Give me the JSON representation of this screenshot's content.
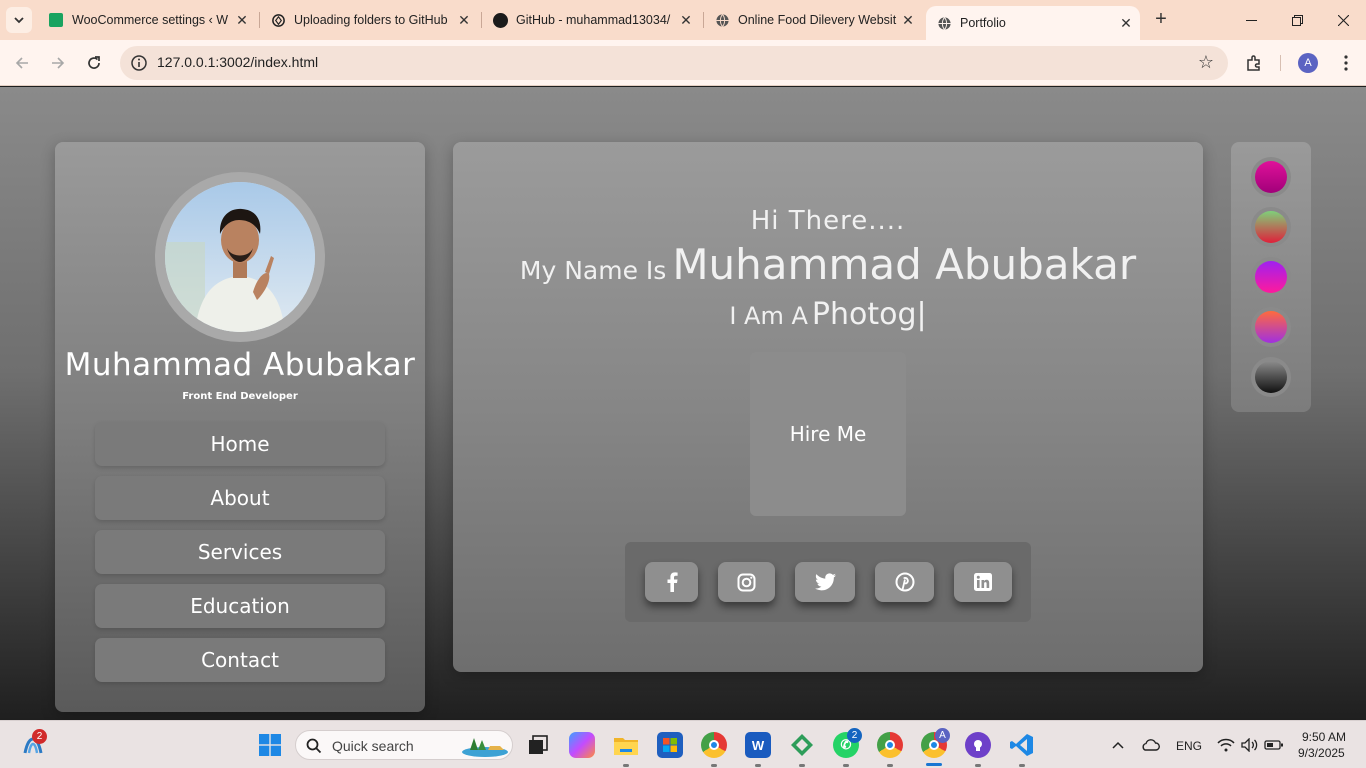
{
  "browser": {
    "tabs": [
      {
        "title": "WooCommerce settings ‹ W",
        "icon": "woocommerce-icon",
        "active": false
      },
      {
        "title": "Uploading folders to GitHub",
        "icon": "chatgpt-icon",
        "active": false
      },
      {
        "title": "GitHub - muhammad13034/",
        "icon": "github-icon",
        "active": false
      },
      {
        "title": "Online Food Dilevery Websit",
        "icon": "globe-icon",
        "active": false
      },
      {
        "title": "Portfolio",
        "icon": "globe-icon",
        "active": true
      }
    ],
    "url": "127.0.0.1:3002/index.html",
    "profile_initial": "A"
  },
  "sidebar": {
    "name": "Muhammad Abubakar",
    "role": "Front End Developer",
    "nav": [
      "Home",
      "About",
      "Services",
      "Education",
      "Contact"
    ]
  },
  "hero": {
    "greeting": "Hi There....",
    "name_lead": "My Name Is",
    "name": "Muhammad Abubakar",
    "role_lead": "I Am A",
    "typed_text": "Photog|",
    "hire_label": "Hire Me",
    "socials": [
      "facebook-icon",
      "instagram-icon",
      "twitter-icon",
      "pinterest-icon",
      "linkedin-icon"
    ]
  },
  "theme_swatches": [
    {
      "name": "pink",
      "from": "#e0119a",
      "to": "#a1007a"
    },
    {
      "name": "green-red",
      "from": "#7fd07a",
      "to": "#e0203a"
    },
    {
      "name": "purple-pink",
      "from": "#a020f0",
      "to": "#ff1a9c"
    },
    {
      "name": "orange-purple",
      "from": "#ff6a3d",
      "to": "#a030e0"
    },
    {
      "name": "gray-black",
      "from": "#8c8c8c",
      "to": "#111111"
    }
  ],
  "taskbar": {
    "search_placeholder": "Quick search",
    "language": "ENG",
    "time": "9:50 AM",
    "date": "9/3/2025",
    "widgets_badge": "2",
    "whatsapp_badge": "2",
    "chrome_profile_badge": "A"
  }
}
